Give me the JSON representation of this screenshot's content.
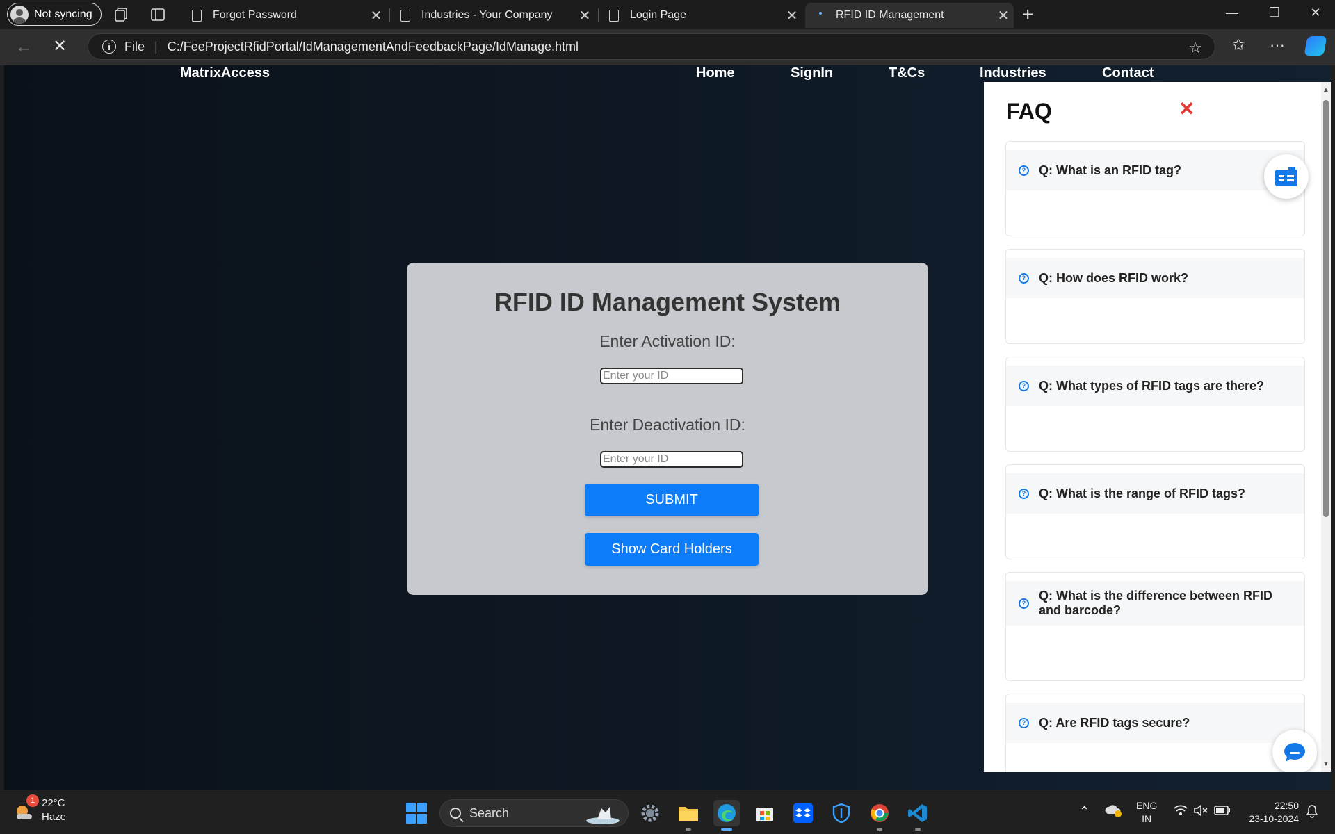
{
  "browser": {
    "profile_label": "Not syncing",
    "tabs": [
      {
        "title": "Forgot Password"
      },
      {
        "title": "Industries - Your Company"
      },
      {
        "title": "Login Page"
      },
      {
        "title": "RFID ID Management",
        "active": true
      }
    ],
    "address": {
      "scheme_label": "File",
      "url": "C:/FeeProjectRfidPortal/IdManagementAndFeedbackPage/IdManage.html"
    }
  },
  "page": {
    "brand": "MatrixAccess",
    "nav": [
      "Home",
      "SignIn",
      "T&Cs",
      "Industries",
      "Contact"
    ],
    "card": {
      "title": "RFID ID Management System",
      "activation_label": "Enter Activation ID:",
      "activation_placeholder": "Enter your ID",
      "deactivation_label": "Enter Deactivation ID:",
      "deactivation_placeholder": "Enter your ID",
      "submit_label": "SUBMIT",
      "show_holders_label": "Show Card Holders"
    },
    "faq": {
      "title": "FAQ",
      "close_glyph": "✕",
      "items": [
        {
          "q": "Q: What is an RFID tag?"
        },
        {
          "q": "Q: How does RFID work?"
        },
        {
          "q": "Q: What types of RFID tags are there?"
        },
        {
          "q": "Q: What is the range of RFID tags?"
        },
        {
          "q": "Q: What is the difference between RFID and barcode?"
        },
        {
          "q": "Q: Are RFID tags secure?"
        }
      ]
    }
  },
  "taskbar": {
    "weather": {
      "temp": "22°C",
      "condition": "Haze",
      "badge": "1"
    },
    "search_label": "Search",
    "lang_top": "ENG",
    "lang_bottom": "IN",
    "time": "22:50",
    "date": "23-10-2024"
  },
  "colors": {
    "accent_button": "#0d7cf9",
    "faq_close": "#e53935",
    "page_bg": "#0f1a27"
  }
}
